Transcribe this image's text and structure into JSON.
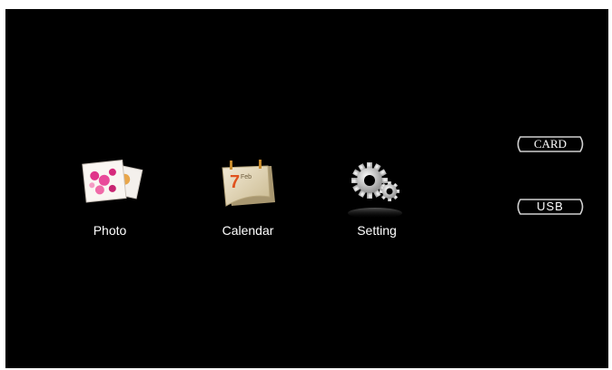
{
  "menu": {
    "items": [
      {
        "label": "Photo",
        "icon": "photo-icon"
      },
      {
        "label": "Calendar",
        "icon": "calendar-icon"
      },
      {
        "label": "Setting",
        "icon": "gear-icon"
      }
    ]
  },
  "calendar_icon": {
    "day": "7",
    "month": "Feb"
  },
  "sources": {
    "card_label": "CARD",
    "usb_label": "USB"
  },
  "colors": {
    "background": "#000000",
    "text": "#ffffff",
    "button_border": "#d0d0d0"
  }
}
